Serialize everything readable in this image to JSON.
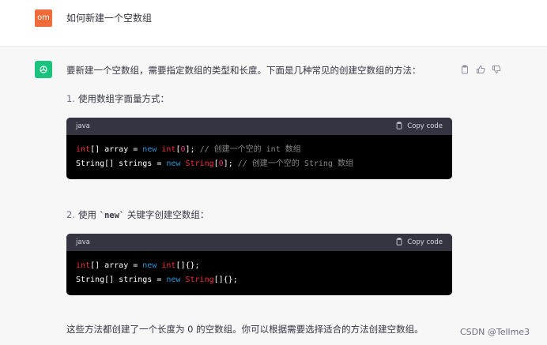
{
  "user": {
    "avatar_text": "om",
    "message": "如何新建一个空数组"
  },
  "assistant": {
    "intro": "要新建一个空数组，需要指定数组的类型和长度。下面是几种常见的创建空数组的方法：",
    "items": [
      {
        "number": "1.",
        "text": "使用数组字面量方式：",
        "code_lang": "java",
        "copy_label": "Copy code",
        "code_lines": [
          [
            {
              "t": "int",
              "c": "ty"
            },
            {
              "t": "[] array = ",
              "c": ""
            },
            {
              "t": "new",
              "c": "kw"
            },
            {
              "t": " ",
              "c": ""
            },
            {
              "t": "int",
              "c": "ty"
            },
            {
              "t": "[",
              "c": ""
            },
            {
              "t": "0",
              "c": "nm"
            },
            {
              "t": "]; ",
              "c": ""
            },
            {
              "t": "// 创建一个空的 int 数组",
              "c": "cm"
            }
          ],
          [
            {
              "t": "String[] strings = ",
              "c": ""
            },
            {
              "t": "new",
              "c": "kw"
            },
            {
              "t": " ",
              "c": ""
            },
            {
              "t": "String",
              "c": "ty"
            },
            {
              "t": "[",
              "c": ""
            },
            {
              "t": "0",
              "c": "nm"
            },
            {
              "t": "]; ",
              "c": ""
            },
            {
              "t": "// 创建一个空的 String 数组",
              "c": "cm"
            }
          ]
        ]
      },
      {
        "number": "2.",
        "text_before": "使用 ",
        "text_code": "`new`",
        "text_after": " 关键字创建空数组：",
        "code_lang": "java",
        "copy_label": "Copy code",
        "code_lines": [
          [
            {
              "t": "int",
              "c": "ty"
            },
            {
              "t": "[] array = ",
              "c": ""
            },
            {
              "t": "new",
              "c": "kw"
            },
            {
              "t": " ",
              "c": ""
            },
            {
              "t": "int",
              "c": "ty"
            },
            {
              "t": "[]{};",
              "c": ""
            }
          ],
          [
            {
              "t": "String[] strings = ",
              "c": ""
            },
            {
              "t": "new",
              "c": "kw"
            },
            {
              "t": " ",
              "c": ""
            },
            {
              "t": "String",
              "c": "ty"
            },
            {
              "t": "[]{};",
              "c": ""
            }
          ]
        ]
      }
    ],
    "closing": "这些方法都创建了一个长度为 0 的空数组。你可以根据需要选择适合的方法创建空数组。"
  },
  "watermark": "CSDN @Tellme3",
  "colors": {
    "user_avatar": "#f06a3a",
    "bot_avatar": "#19c37d",
    "keyword": "#2e95d3",
    "type": "#f22c3d",
    "number": "#df3079",
    "comment": "#8a8a8a"
  },
  "icons": [
    "openai-logo-icon",
    "clipboard-icon",
    "thumbs-up-icon",
    "thumbs-down-icon"
  ]
}
